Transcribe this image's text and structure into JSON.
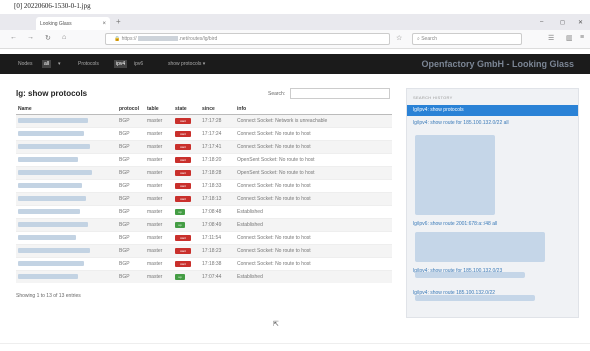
{
  "caption": "[0] 20220606-1530-0-1.jpg",
  "browser": {
    "tab_title": "Looking Glass",
    "tab_close": "×",
    "new_tab": "+",
    "url_prefix": "https://",
    "url_mid": ".net/routes/lg/bird",
    "search_placeholder": "Search",
    "win_min": "–",
    "win_max": "◻",
    "win_close": "✕"
  },
  "appnav": {
    "items": [
      "Nodes",
      "all",
      "▾",
      "Protocols",
      "ipv4",
      "ipv6",
      "show protocols ▾"
    ],
    "active_index": [
      1,
      4
    ],
    "brand": "Openfactory GmbH - Looking Glass"
  },
  "main": {
    "title": "lg: show protocols",
    "search_label": "Search:",
    "columns": [
      "Name",
      "protocol",
      "table",
      "state",
      "since",
      "info"
    ],
    "rows": [
      {
        "proto": "BGP",
        "table": "master",
        "state": "start",
        "since": "17:17:28",
        "info": "Connect Socket: Network is unreachable"
      },
      {
        "proto": "BGP",
        "table": "master",
        "state": "start",
        "since": "17:17:24",
        "info": "Connect Socket: No route to host"
      },
      {
        "proto": "BGP",
        "table": "master",
        "state": "start",
        "since": "17:17:41",
        "info": "Connect Socket: No route to host"
      },
      {
        "proto": "BGP",
        "table": "master",
        "state": "start",
        "since": "17:18:20",
        "info": "OpenSent Socket: No route to host"
      },
      {
        "proto": "BGP",
        "table": "master",
        "state": "start",
        "since": "17:18:28",
        "info": "OpenSent Socket: No route to host"
      },
      {
        "proto": "BGP",
        "table": "master",
        "state": "start",
        "since": "17:18:33",
        "info": "Connect Socket: No route to host"
      },
      {
        "proto": "BGP",
        "table": "master",
        "state": "start",
        "since": "17:18:13",
        "info": "Connect Socket: No route to host"
      },
      {
        "proto": "BGP",
        "table": "master",
        "state": "up",
        "since": "17:08:48",
        "info": "Established"
      },
      {
        "proto": "BGP",
        "table": "master",
        "state": "up",
        "since": "17:08:49",
        "info": "Established"
      },
      {
        "proto": "BGP",
        "table": "master",
        "state": "start",
        "since": "17:11:54",
        "info": "Connect Socket: No route to host"
      },
      {
        "proto": "BGP",
        "table": "master",
        "state": "start",
        "since": "17:18:23",
        "info": "Connect Socket: No route to host"
      },
      {
        "proto": "BGP",
        "table": "master",
        "state": "start",
        "since": "17:18:38",
        "info": "Connect Socket: No route to host"
      },
      {
        "proto": "BGP",
        "table": "master",
        "state": "up",
        "since": "17:07:44",
        "info": "Established"
      }
    ],
    "badge_start": "start",
    "badge_up": "up",
    "entries_info": "Showing 1 to 13 of 13 entries"
  },
  "history": {
    "heading": "SEARCH HISTORY",
    "items": [
      {
        "text": "lg/ipv4: show protocols",
        "active": true
      },
      {
        "text": "lg/ipv4: show route for 185.100.132.0/22 all",
        "active": false
      },
      {
        "text": "lg/ipv6: show route 2001:678:a::/48 all",
        "active": false
      },
      {
        "text": "lg/ipv4: show route for 185.100.132.0/23",
        "active": false
      },
      {
        "text": "lg/ipv4: show route 185.100.132.0/22",
        "active": false
      }
    ]
  },
  "colors": {
    "accent": "#2a82d6",
    "start": "#c9302c",
    "up": "#449d44",
    "navbar": "#1b1b1b"
  }
}
